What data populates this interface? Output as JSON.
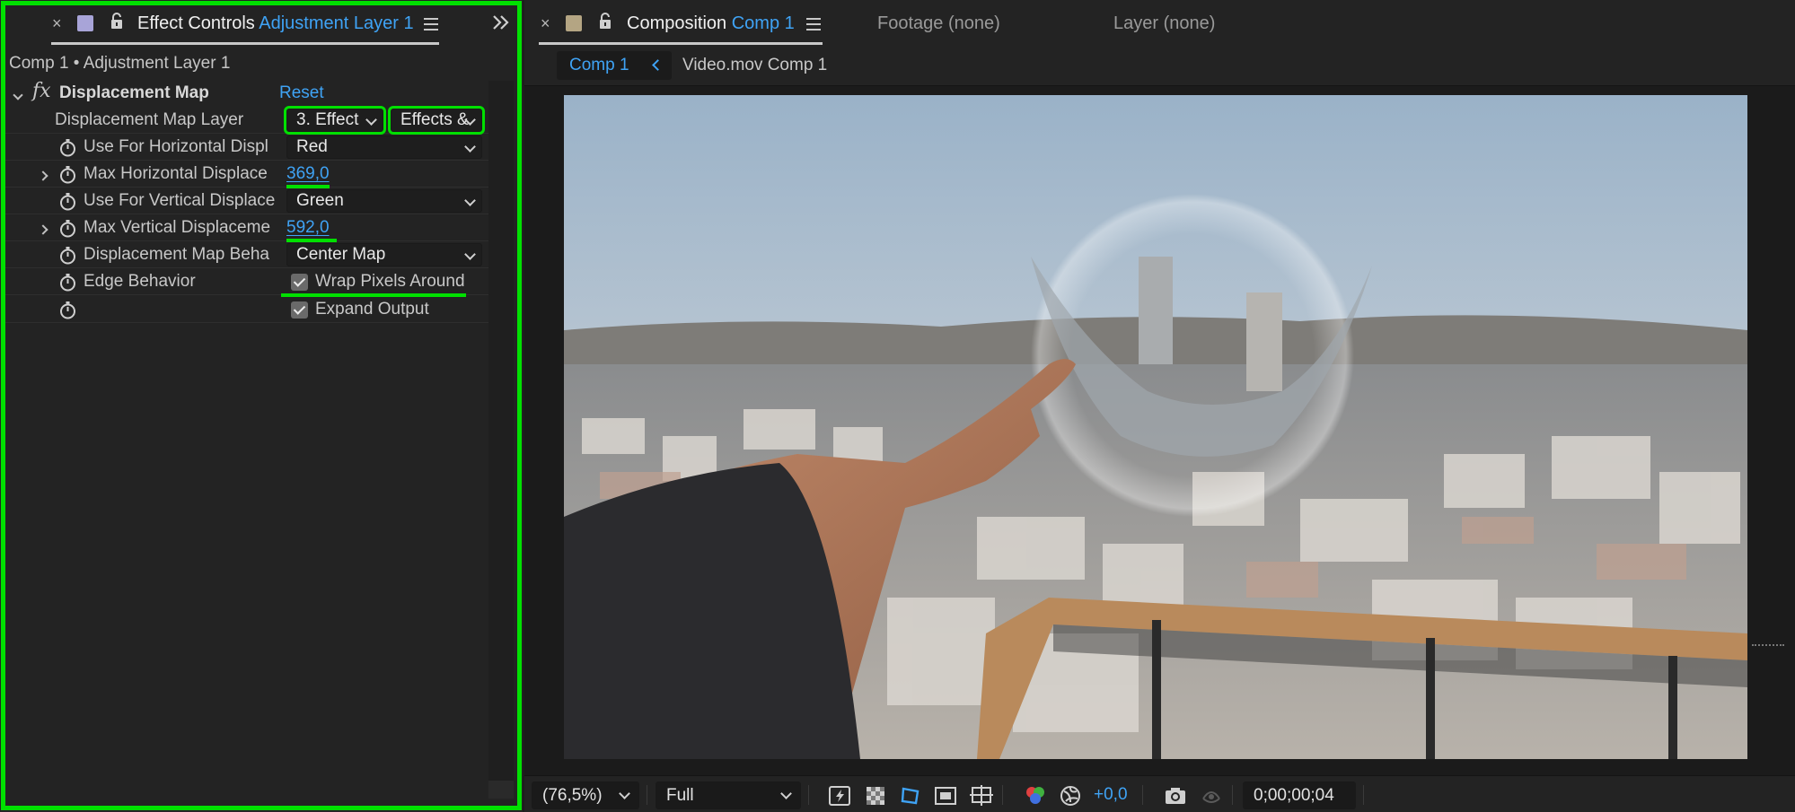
{
  "effect_controls": {
    "tab_prefix": "Effect Controls",
    "tab_layer": "Adjustment Layer 1",
    "breadcrumb": "Comp 1 • Adjustment Layer 1",
    "effect": {
      "name": "Displacement Map",
      "fx_label": "fx",
      "reset_label": "Reset"
    },
    "rows": {
      "map_layer": {
        "label": "Displacement Map Layer",
        "layer_value": "3. Effect",
        "source_value": "Effects &"
      },
      "use_horizontal": {
        "label": "Use For Horizontal Displ",
        "value": "Red"
      },
      "max_horizontal": {
        "label": "Max Horizontal Displace",
        "value": "369,0"
      },
      "use_vertical": {
        "label": "Use For Vertical Displace",
        "value": "Green"
      },
      "max_vertical": {
        "label": "Max Vertical Displaceme",
        "value": "592,0"
      },
      "map_behavior": {
        "label": "Displacement Map Beha",
        "value": "Center Map"
      },
      "edge_behavior": {
        "label": "Edge Behavior",
        "check_label": "Wrap Pixels Around",
        "checked": true
      },
      "expand_output": {
        "label": "",
        "check_label": "Expand Output",
        "checked": true
      }
    }
  },
  "composition": {
    "tab_prefix": "Composition",
    "tab_comp": "Comp 1",
    "footage_tab": "Footage (none)",
    "layer_tab": "Layer (none)",
    "subtabs": [
      "Comp 1",
      "Video.mov Comp 1"
    ],
    "toolbar": {
      "zoom": "(76,5%)",
      "resolution": "Full",
      "exposure": "+0,0",
      "timecode": "0;00;00;04"
    }
  },
  "colors": {
    "accent_blue": "#3fa3f5",
    "highlight_green": "#00e000",
    "panel_bg": "#232323"
  },
  "icons": [
    "close-icon",
    "layer-color-swatch-icon",
    "lock-icon",
    "panel-menu-icon",
    "expand-panels-icon",
    "stopwatch-icon",
    "fx-icon",
    "chevron-down-icon",
    "fast-preview-icon",
    "transparency-grid-icon",
    "mask-path-icon",
    "region-of-interest-icon",
    "guides-icon",
    "color-channels-icon",
    "exposure-reset-icon",
    "snapshot-icon",
    "show-snapshot-icon"
  ]
}
